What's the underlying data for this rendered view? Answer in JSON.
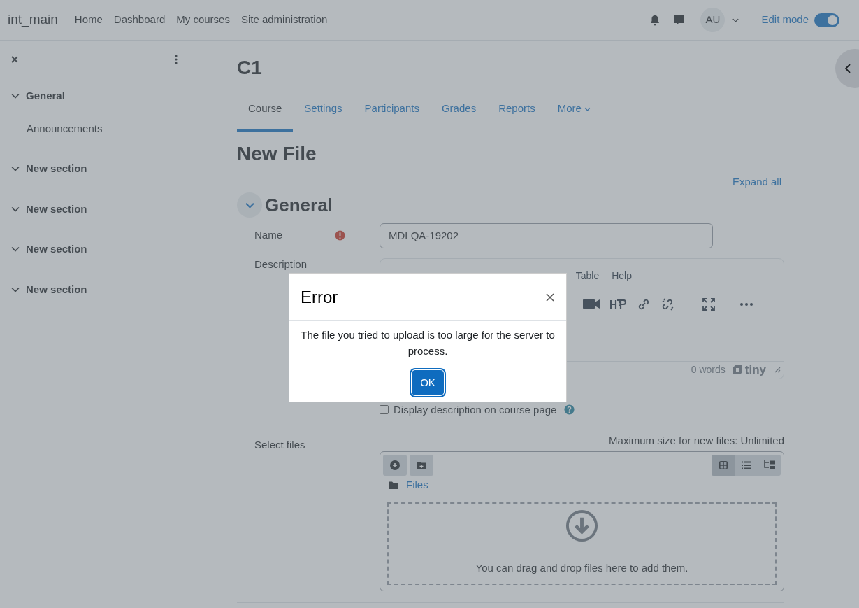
{
  "site_name": "int_main",
  "nav": [
    {
      "label": "Home"
    },
    {
      "label": "Dashboard"
    },
    {
      "label": "My courses"
    },
    {
      "label": "Site administration"
    }
  ],
  "user": {
    "initials": "AU"
  },
  "edit_mode": {
    "label": "Edit mode",
    "on": true
  },
  "drawer": {
    "sections": [
      {
        "label": "General",
        "expanded": true,
        "children": [
          {
            "label": "Announcements"
          }
        ]
      },
      {
        "label": "New section",
        "expanded": true
      },
      {
        "label": "New section",
        "expanded": true
      },
      {
        "label": "New section",
        "expanded": true
      },
      {
        "label": "New section",
        "expanded": true
      }
    ]
  },
  "course_title": "C1",
  "tabs": [
    {
      "label": "Course",
      "selected": true
    },
    {
      "label": "Settings",
      "selected": false
    },
    {
      "label": "Participants",
      "selected": false
    },
    {
      "label": "Grades",
      "selected": false
    },
    {
      "label": "Reports",
      "selected": false
    },
    {
      "label": "More",
      "selected": false,
      "kind": "dropdown"
    }
  ],
  "page_title": "New File",
  "expand_all": "Expand all",
  "section": {
    "title": "General",
    "expanded": true
  },
  "name_field": {
    "label": "Name",
    "required": true,
    "value": "MDLQA-19202"
  },
  "description_field": {
    "label": "Description",
    "menu": [
      "Table",
      "Help"
    ],
    "word_count": "0 words",
    "brand": "tiny"
  },
  "display_checkbox": {
    "label": "Display description on course page",
    "checked": false
  },
  "files_field": {
    "label": "Select files",
    "max_size": "Maximum size for new files: Unlimited",
    "folder": "Files",
    "views": [
      {
        "kind": "grid",
        "selected": true
      },
      {
        "kind": "list",
        "selected": false
      },
      {
        "kind": "tree",
        "selected": false
      }
    ],
    "drop_text": "You can drag and drop files here to add them."
  },
  "modal": {
    "title": "Error",
    "message": "The file you tried to upload is too large for the server to process.",
    "button": "OK"
  }
}
